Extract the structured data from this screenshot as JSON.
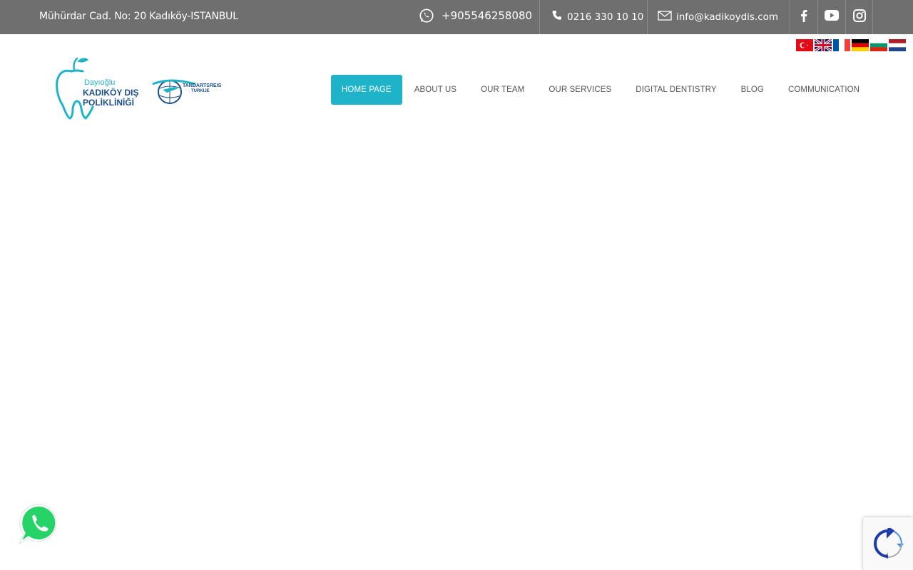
{
  "topbar": {
    "address": "Mühürdar Cad. No: 20 Kadıköy-ISTANBUL",
    "whatsapp": "+905546258080",
    "phone": "0216 330 10 10",
    "email": "info@kadikoydis.com",
    "social": [
      "facebook-icon",
      "youtube-icon",
      "instagram-icon"
    ]
  },
  "languages": [
    "tr",
    "en",
    "fr",
    "de",
    "bg",
    "nl"
  ],
  "logo": {
    "line1": "Dayıoğlu",
    "line2": "KADIKÖY DIŞ",
    "line3": "POLİKLİNİĞİ",
    "partner_line1": "TANDARTSREIS",
    "partner_line2": "TURKIJE"
  },
  "nav": {
    "items": [
      {
        "label": "HOME PAGE"
      },
      {
        "label": "ABOUT US"
      },
      {
        "label": "OUR TEAM"
      },
      {
        "label": "OUR SERVICES"
      },
      {
        "label": "DIGITAL DENTISTRY"
      },
      {
        "label": "BLOG"
      },
      {
        "label": "COMMUNICATION"
      }
    ]
  },
  "colors": {
    "topbar": "#6f6f6f",
    "accent": "#1fb3c9",
    "whatsapp": "#25d366"
  }
}
